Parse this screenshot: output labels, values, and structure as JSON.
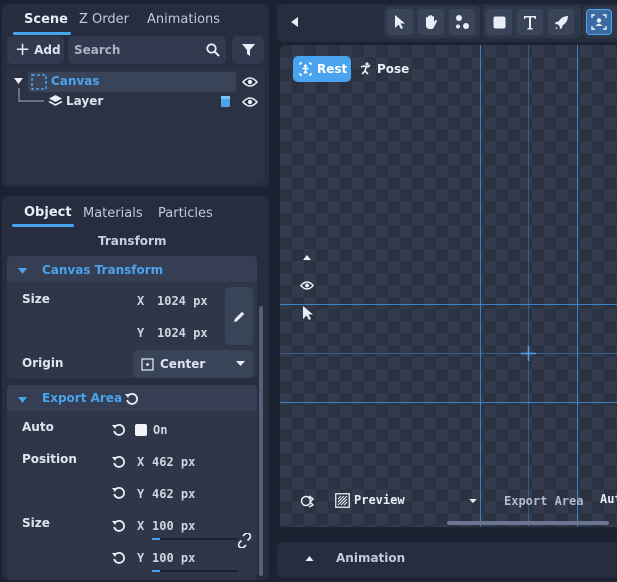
{
  "scene_panel": {
    "tabs": [
      {
        "label": "Scene"
      },
      {
        "label": "Z Order"
      },
      {
        "label": "Animations"
      }
    ],
    "add_label": "Add",
    "search_placeholder": "Search",
    "tree": [
      {
        "label": "Canvas"
      },
      {
        "label": "Layer"
      }
    ]
  },
  "inspector": {
    "tabs": [
      {
        "label": "Object"
      },
      {
        "label": "Materials"
      },
      {
        "label": "Particles"
      }
    ],
    "section_title": "Transform",
    "canvas_transform": {
      "title": "Canvas Transform",
      "size_label": "Size",
      "x_axis": "X",
      "y_axis": "Y",
      "width": "1024 px",
      "height": "1024 px",
      "origin_label": "Origin",
      "origin_value": "Center"
    },
    "export_area": {
      "title": "Export Area",
      "auto_label": "Auto",
      "auto_value": "On",
      "position_label": "Position",
      "pos_x": "462 px",
      "pos_y": "462 px",
      "size_label": "Size",
      "size_x": "100 px",
      "size_y": "100 px",
      "x_axis": "X",
      "y_axis": "Y"
    }
  },
  "viewport": {
    "rest_label": "Rest",
    "pose_label": "Pose",
    "preview_label": "Preview",
    "export_area_label": "Export Area",
    "auto_trunc": "Aut"
  },
  "animation_bar": {
    "label": "Animation"
  },
  "colors": {
    "accent": "#4aa3ef",
    "panel": "#252d3e",
    "background": "#1b2231",
    "guide": "#3f8fd9"
  }
}
